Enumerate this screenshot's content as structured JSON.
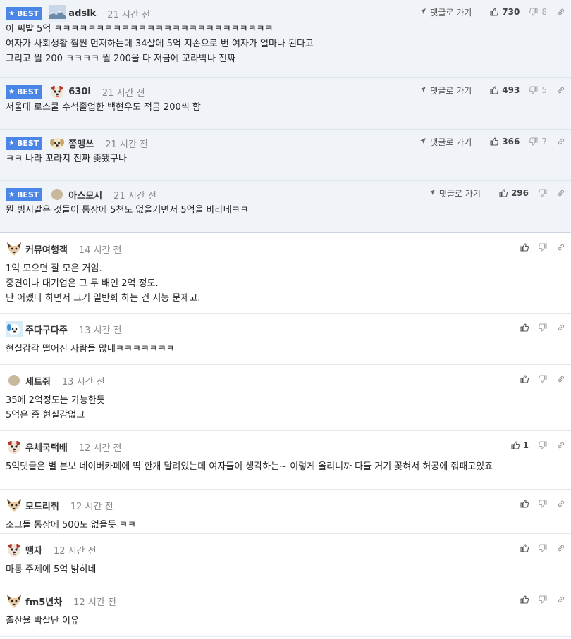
{
  "labels": {
    "best": "BEST",
    "reply_link": "댓글로 가기"
  },
  "comments": [
    {
      "best": true,
      "nick": "adslk",
      "time": "21 시간 전",
      "avatar": "winter-landscape",
      "lines": [
        "이 씨발 5억 ㅋㅋㅋㅋㅋㅋㅋㅋㅋㅋㅋㅋㅋㅋㅋㅋㅋㅋㅋㅋㅋㅋㅋㅋㅋㅋ",
        "여자가 사회생활 훨씬 먼저하는데 34살에 5억 지손으로 번 여자가 얼마나 된다고",
        "그리고 월 200 ㅋㅋㅋㅋ 월 200을 다 저금에 꼬라박나 진짜"
      ],
      "up": "730",
      "down": "8"
    },
    {
      "best": true,
      "nick": "630i",
      "time": "21 시간 전",
      "avatar": "dog-red",
      "lines": [
        "서울대 로스쿨 수석졸업한 백현우도 적금 200씩 함"
      ],
      "up": "493",
      "down": "5"
    },
    {
      "best": true,
      "nick": "쫑맹쓰",
      "time": "21 시간 전",
      "avatar": "puppy",
      "lines": [
        "ㅋㅋ 나라 꼬라지 진짜 좆됐구나"
      ],
      "up": "366",
      "down": "7"
    },
    {
      "best": true,
      "nick": "아스모시",
      "time": "21 시간 전",
      "avatar": "plain-circle",
      "lines": [
        "뭔 빙시같은 것들이 통장에 5천도 없을거면서 5억을 바라네ㅋㅋ"
      ],
      "up": "296",
      "down": ""
    },
    {
      "best": false,
      "nick": "커뮤여행객",
      "time": "14 시간 전",
      "avatar": "fox",
      "lines": [
        "1억 모으면 잘 모은 거임.",
        "중견이나 대기업은 그 두 배인 2억 정도.",
        "난 어쨌다 하면서 그거 일반화 하는 건 지능 문제고."
      ],
      "up": "",
      "down": ""
    },
    {
      "best": false,
      "nick": "주다구다주",
      "time": "13 시간 전",
      "avatar": "blue-dog",
      "lines": [
        "현실감각 떨어진 사람들 많네ㅋㅋㅋㅋㅋㅋㅋ"
      ],
      "up": "",
      "down": ""
    },
    {
      "best": false,
      "nick": "세트줘",
      "time": "13 시간 전",
      "avatar": "plain-circle",
      "lines": [
        "35에 2억정도는 가능한듯",
        "5억은 좀 현실감없고"
      ],
      "up": "",
      "down": ""
    },
    {
      "best": false,
      "nick": "우체국택배",
      "time": "12 시간 전",
      "avatar": "dog-red",
      "lines": [
        "5억댓글은 별 븐보 네이버카페에 딱 한개 달려있는데 여자들이 생각하는~ 이렇게 올리니까 다들 거기 꽂혀서 허공에 줘패고있죠"
      ],
      "up": "1",
      "down": ""
    },
    {
      "best": false,
      "nick": "모드리취",
      "time": "12 시간 전",
      "avatar": "fox",
      "lines": [
        "조그들 통장에 500도 없을듯 ㅋㅋ"
      ],
      "up": "",
      "down": ""
    },
    {
      "best": false,
      "nick": "땡자",
      "time": "12 시간 전",
      "avatar": "dog-red",
      "lines": [
        "마통 주제에 5억 밝히네"
      ],
      "up": "",
      "down": ""
    },
    {
      "best": false,
      "nick": "fm5년차",
      "time": "12 시간 전",
      "avatar": "fox",
      "lines": [
        "출산율 박살난 이유"
      ],
      "up": "",
      "down": ""
    }
  ]
}
